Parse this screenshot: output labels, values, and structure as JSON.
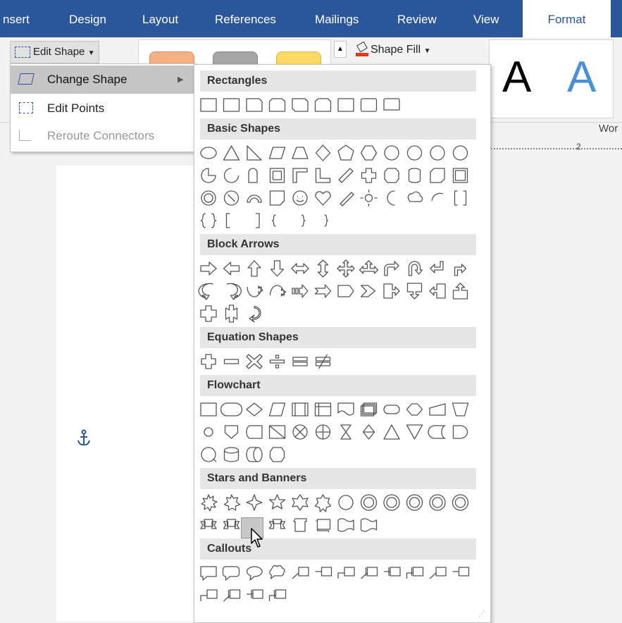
{
  "ribbon": {
    "tabs": [
      "nsert",
      "Design",
      "Layout",
      "References",
      "Mailings",
      "Review",
      "View",
      "Format"
    ],
    "active_tab": "Format",
    "edit_shape_label": "Edit Shape",
    "shape_fill_label": "Shape Fill",
    "wordart_letter": "A",
    "wordart_group_label": "Wor",
    "ruler_mark": "2"
  },
  "edit_shape_menu": {
    "items": [
      {
        "label": "Change Shape",
        "icon": "change-shape-icon",
        "state": "highlighted",
        "has_submenu": true
      },
      {
        "label": "Edit Points",
        "icon": "edit-points-icon",
        "state": "enabled"
      },
      {
        "label": "Reroute Connectors",
        "icon": "reroute-connectors-icon",
        "state": "disabled"
      }
    ]
  },
  "shapes_gallery": {
    "sections": [
      {
        "title": "Rectangles",
        "count": 9
      },
      {
        "title": "Basic Shapes",
        "count": 42
      },
      {
        "title": "Block Arrows",
        "count": 27
      },
      {
        "title": "Equation Shapes",
        "count": 6
      },
      {
        "title": "Flowchart",
        "count": 28
      },
      {
        "title": "Stars and Banners",
        "count": 20
      },
      {
        "title": "Callouts",
        "count": 16
      }
    ]
  },
  "document": {
    "anchor_icon": "anchor-icon"
  },
  "colors": {
    "ribbon_blue": "#2b579a",
    "menu_highlight": "#c5c5c5",
    "section_header_bg": "#e6e6e6",
    "shape_stroke": "#555555",
    "wordart_blue": "#4a90d9"
  }
}
